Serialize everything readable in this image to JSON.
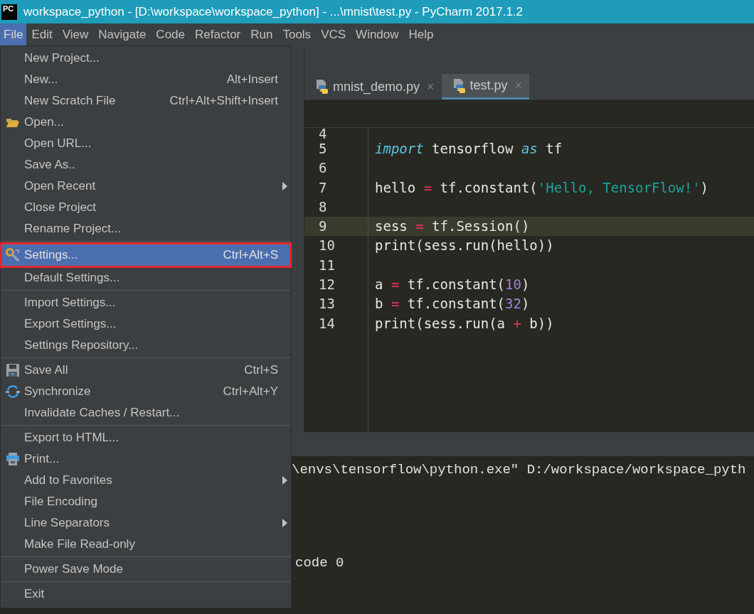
{
  "window": {
    "app_icon": "PC",
    "title": "workspace_python - [D:\\workspace\\workspace_python] - ...\\mnist\\test.py - PyCharm 2017.1.2"
  },
  "menu_bar": [
    {
      "label": "File",
      "selected": true
    },
    {
      "label": "Edit",
      "selected": false
    },
    {
      "label": "View",
      "selected": false
    },
    {
      "label": "Navigate",
      "selected": false
    },
    {
      "label": "Code",
      "selected": false
    },
    {
      "label": "Refactor",
      "selected": false
    },
    {
      "label": "Run",
      "selected": false
    },
    {
      "label": "Tools",
      "selected": false
    },
    {
      "label": "VCS",
      "selected": false
    },
    {
      "label": "Window",
      "selected": false
    },
    {
      "label": "Help",
      "selected": false
    }
  ],
  "file_menu": {
    "groups": [
      [
        {
          "label": "New Project...",
          "submenu": false,
          "selected": false
        },
        {
          "label": "New...",
          "shortcut": "Alt+Insert",
          "submenu": false,
          "selected": false
        },
        {
          "label": "New Scratch File",
          "shortcut": "Ctrl+Alt+Shift+Insert",
          "submenu": false,
          "selected": false
        },
        {
          "label": "Open...",
          "kind": "folder",
          "submenu": false,
          "selected": false
        },
        {
          "label": "Open URL...",
          "submenu": false,
          "selected": false
        },
        {
          "label": "Save As..",
          "submenu": false,
          "selected": false
        },
        {
          "label": "Open Recent",
          "submenu": true,
          "selected": false
        },
        {
          "label": "Close Project",
          "submenu": false,
          "selected": false
        },
        {
          "label": "Rename Project...",
          "submenu": false,
          "selected": false
        }
      ],
      [
        {
          "label": "Settings...",
          "shortcut": "Ctrl+Alt+S",
          "kind": "settings",
          "submenu": false,
          "selected": true,
          "highlighted": true
        },
        {
          "label": "Default Settings...",
          "submenu": false,
          "selected": false
        }
      ],
      [
        {
          "label": "Import Settings...",
          "submenu": false,
          "selected": false
        },
        {
          "label": "Export Settings...",
          "submenu": false,
          "selected": false
        },
        {
          "label": "Settings Repository...",
          "submenu": false,
          "selected": false
        }
      ],
      [
        {
          "label": "Save All",
          "shortcut": "Ctrl+S",
          "kind": "save",
          "submenu": false,
          "selected": false
        },
        {
          "label": "Synchronize",
          "shortcut": "Ctrl+Alt+Y",
          "kind": "sync",
          "submenu": false,
          "selected": false
        },
        {
          "label": "Invalidate Caches / Restart...",
          "submenu": false,
          "selected": false
        }
      ],
      [
        {
          "label": "Export to HTML...",
          "submenu": false,
          "selected": false
        },
        {
          "label": "Print...",
          "kind": "print",
          "submenu": false,
          "selected": false
        },
        {
          "label": "Add to Favorites",
          "submenu": true,
          "selected": false
        },
        {
          "label": "File Encoding",
          "submenu": false,
          "selected": false
        },
        {
          "label": "Line Separators",
          "submenu": true,
          "selected": false
        },
        {
          "label": "Make File Read-only",
          "submenu": false,
          "selected": false
        }
      ],
      [
        {
          "label": "Power Save Mode",
          "submenu": false,
          "selected": false
        }
      ],
      [
        {
          "label": "Exit",
          "submenu": false,
          "selected": false
        }
      ]
    ]
  },
  "editor": {
    "tabs": [
      {
        "label": "mnist_demo.py",
        "close": "×",
        "selected": false
      },
      {
        "label": "test.py",
        "close": "×",
        "selected": true
      }
    ],
    "lines": [
      {
        "number": "4",
        "current": false
      },
      {
        "number": "5",
        "current": false,
        "tokens": [
          {
            "text": "import",
            "kind": "keyword"
          },
          {
            "text": " tensorflow ",
            "kind": "plain"
          },
          {
            "text": "as",
            "kind": "keyword"
          },
          {
            "text": " tf",
            "kind": "plain"
          }
        ]
      },
      {
        "number": "6",
        "current": false
      },
      {
        "number": "7",
        "current": false,
        "tokens": [
          {
            "text": "hello ",
            "kind": "plain"
          },
          {
            "text": "=",
            "kind": "operator"
          },
          {
            "text": " tf.constant(",
            "kind": "plain"
          },
          {
            "text": "'Hello, TensorFlow!'",
            "kind": "string"
          },
          {
            "text": ")",
            "kind": "plain"
          }
        ]
      },
      {
        "number": "8",
        "current": false
      },
      {
        "number": "9",
        "current": true,
        "tokens": [
          {
            "text": "sess ",
            "kind": "plain"
          },
          {
            "text": "=",
            "kind": "operator"
          },
          {
            "text": " tf.Session()",
            "kind": "plain"
          }
        ]
      },
      {
        "number": "10",
        "current": false,
        "tokens": [
          {
            "text": "print(sess.run(hello))",
            "kind": "plain"
          }
        ]
      },
      {
        "number": "11",
        "current": false
      },
      {
        "number": "12",
        "current": false,
        "tokens": [
          {
            "text": "a ",
            "kind": "plain"
          },
          {
            "text": "=",
            "kind": "operator"
          },
          {
            "text": " tf.constant(",
            "kind": "plain"
          },
          {
            "text": "10",
            "kind": "number"
          },
          {
            "text": ")",
            "kind": "plain"
          }
        ]
      },
      {
        "number": "13",
        "current": false,
        "tokens": [
          {
            "text": "b ",
            "kind": "plain"
          },
          {
            "text": "=",
            "kind": "operator"
          },
          {
            "text": " tf.constant(",
            "kind": "plain"
          },
          {
            "text": "32",
            "kind": "number"
          },
          {
            "text": ")",
            "kind": "plain"
          }
        ]
      },
      {
        "number": "14",
        "current": false,
        "tokens": [
          {
            "text": "print(sess.run(a ",
            "kind": "plain"
          },
          {
            "text": "+",
            "kind": "operator"
          },
          {
            "text": " b))",
            "kind": "plain"
          }
        ]
      }
    ]
  },
  "console": {
    "lines": [
      "\\envs\\tensorflow\\python.exe\" D:/workspace/workspace_pyth",
      "code 0"
    ]
  }
}
